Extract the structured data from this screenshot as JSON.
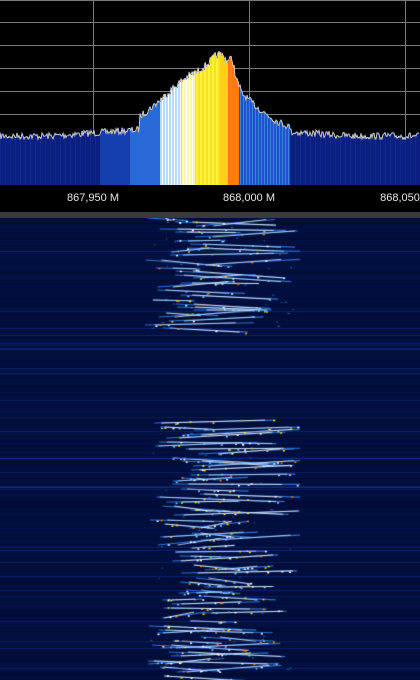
{
  "spectrum": {
    "frequency_labels": {
      "left": "867,950 M",
      "center": "868,000 M",
      "right": "868,050"
    }
  },
  "colors": {
    "background": "#000000",
    "waterfall_background": "#000a2e",
    "grid": "#7a7a7a",
    "trace": "#c8c8c8",
    "splitter": "#3a3a3a",
    "label_text": "#e6e6e6"
  }
}
